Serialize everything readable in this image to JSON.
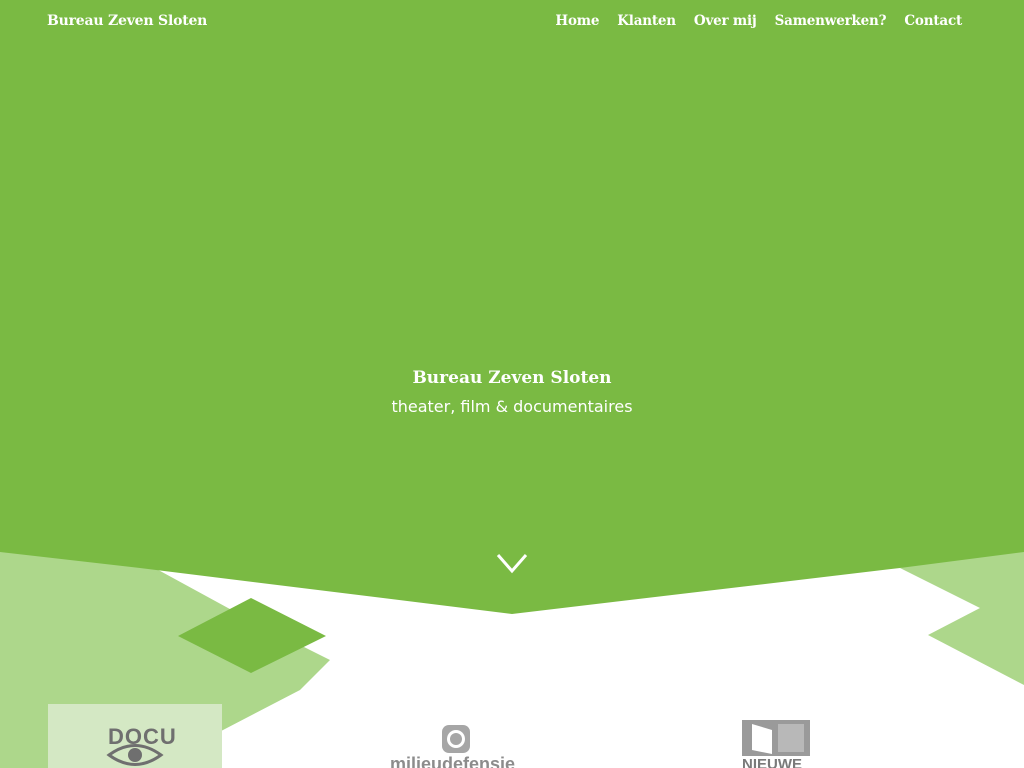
{
  "header": {
    "brand": "Bureau Zeven Sloten",
    "nav": [
      "Home",
      "Klanten",
      "Over mij",
      "Samenwerken?",
      "Contact"
    ]
  },
  "hero": {
    "title": "Bureau Zeven Sloten",
    "subtitle": "theater, film & documentaires"
  },
  "logos": {
    "docu": "DOCU",
    "milieudefensie": "milieudefensie",
    "nieuwe": "NIEUWE"
  },
  "colors": {
    "green": "#7aba43",
    "light_green": "#add78b",
    "pale_green": "#d4e8c4",
    "logo_gray": "#8c8c8c"
  }
}
